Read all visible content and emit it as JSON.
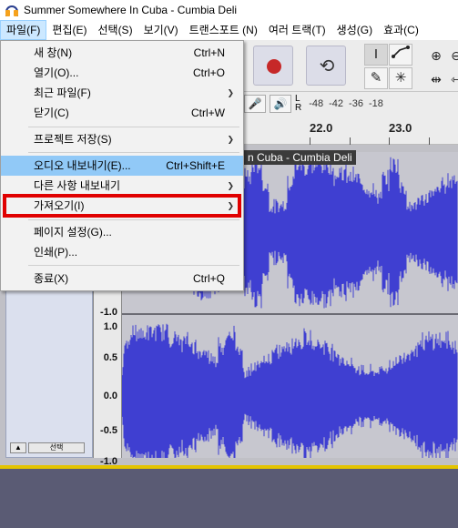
{
  "window": {
    "title": "Summer Somewhere In Cuba - Cumbia Deli"
  },
  "menubar": {
    "items": [
      {
        "label": "파일(F)"
      },
      {
        "label": "편집(E)"
      },
      {
        "label": "선택(S)"
      },
      {
        "label": "보기(V)"
      },
      {
        "label": "트랜스포트 (N)"
      },
      {
        "label": "여러 트랙(T)"
      },
      {
        "label": "생성(G)"
      },
      {
        "label": "효과(C)"
      }
    ]
  },
  "file_menu": {
    "items": [
      {
        "label": "새 창(N)",
        "shortcut": "Ctrl+N"
      },
      {
        "label": "열기(O)...",
        "shortcut": "Ctrl+O"
      },
      {
        "label": "최근 파일(F)",
        "shortcut": ""
      },
      {
        "label": "닫기(C)",
        "shortcut": "Ctrl+W"
      },
      {
        "label": "프로젝트 저장(S)",
        "shortcut": ""
      },
      {
        "label": "오디오 내보내기(E)...",
        "shortcut": "Ctrl+Shift+E"
      },
      {
        "label": "다른 사항 내보내기",
        "shortcut": ""
      },
      {
        "label": "가져오기(I)",
        "shortcut": ""
      },
      {
        "label": "페이지 설정(G)...",
        "shortcut": ""
      },
      {
        "label": "인쇄(P)...",
        "shortcut": ""
      },
      {
        "label": "종료(X)",
        "shortcut": "Ctrl+Q"
      }
    ]
  },
  "meter": {
    "left_label": "L",
    "right_label": "R",
    "db_marks": [
      "-48",
      "-42",
      "-36",
      "-18"
    ]
  },
  "timeline": {
    "labels": [
      "22.0",
      "23.0"
    ]
  },
  "track": {
    "title": "n Cuba - Cumbia Deli",
    "collapse_label": "▲",
    "select_label": "선택",
    "scale": [
      "-1.0",
      "1.0",
      "0.5",
      "0.0",
      "-0.5",
      "-1.0"
    ]
  },
  "colors": {
    "waveform": "#3f3fd1",
    "highlight": "#91c9f7",
    "annotation": "#e00000"
  }
}
